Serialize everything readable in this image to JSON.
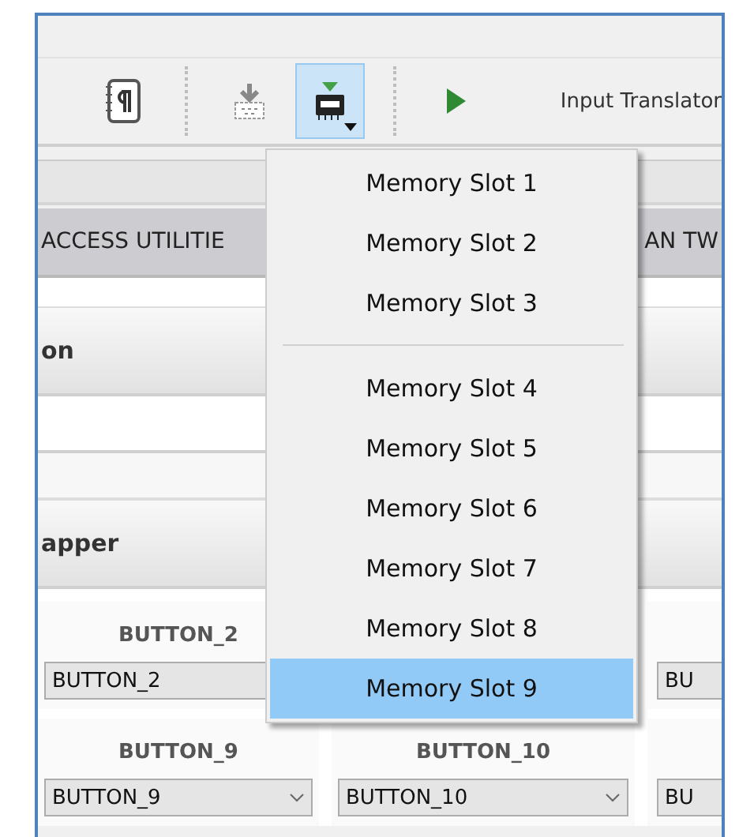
{
  "toolbar": {
    "items": [
      {
        "kind": "paragraph",
        "selected": false
      },
      {
        "kind": "grip"
      },
      {
        "kind": "download",
        "selected": false
      },
      {
        "kind": "memory",
        "selected": true
      },
      {
        "kind": "grip"
      },
      {
        "kind": "play",
        "selected": false
      },
      {
        "kind": "label",
        "label": "Input Translator"
      }
    ]
  },
  "tabs": [
    {
      "label": "ACCESS UTILITIE"
    },
    {
      "label": "AN TW"
    }
  ],
  "sections": [
    {
      "title": "on"
    },
    {
      "title": "apper"
    }
  ],
  "button_grid": {
    "rows": [
      [
        {
          "label": "BUTTON_2",
          "value": "BUTTON_2"
        },
        {},
        {
          "value": "BU"
        }
      ],
      [
        {
          "label": "BUTTON_9",
          "value": "BUTTON_9"
        },
        {
          "label": "BUTTON_10",
          "value": "BUTTON_10"
        },
        {
          "value": "BU"
        }
      ]
    ]
  },
  "memory_menu": {
    "items": [
      {
        "label": "Memory Slot 1",
        "selected": false
      },
      {
        "label": "Memory Slot 2",
        "selected": false
      },
      {
        "label": "Memory Slot 3",
        "selected": false
      },
      {
        "kind": "separator"
      },
      {
        "label": "Memory Slot 4",
        "selected": false
      },
      {
        "label": "Memory Slot 5",
        "selected": false
      },
      {
        "label": "Memory Slot 6",
        "selected": false
      },
      {
        "label": "Memory Slot 7",
        "selected": false
      },
      {
        "label": "Memory Slot 8",
        "selected": false
      },
      {
        "label": "Memory Slot 9",
        "selected": true
      }
    ]
  }
}
